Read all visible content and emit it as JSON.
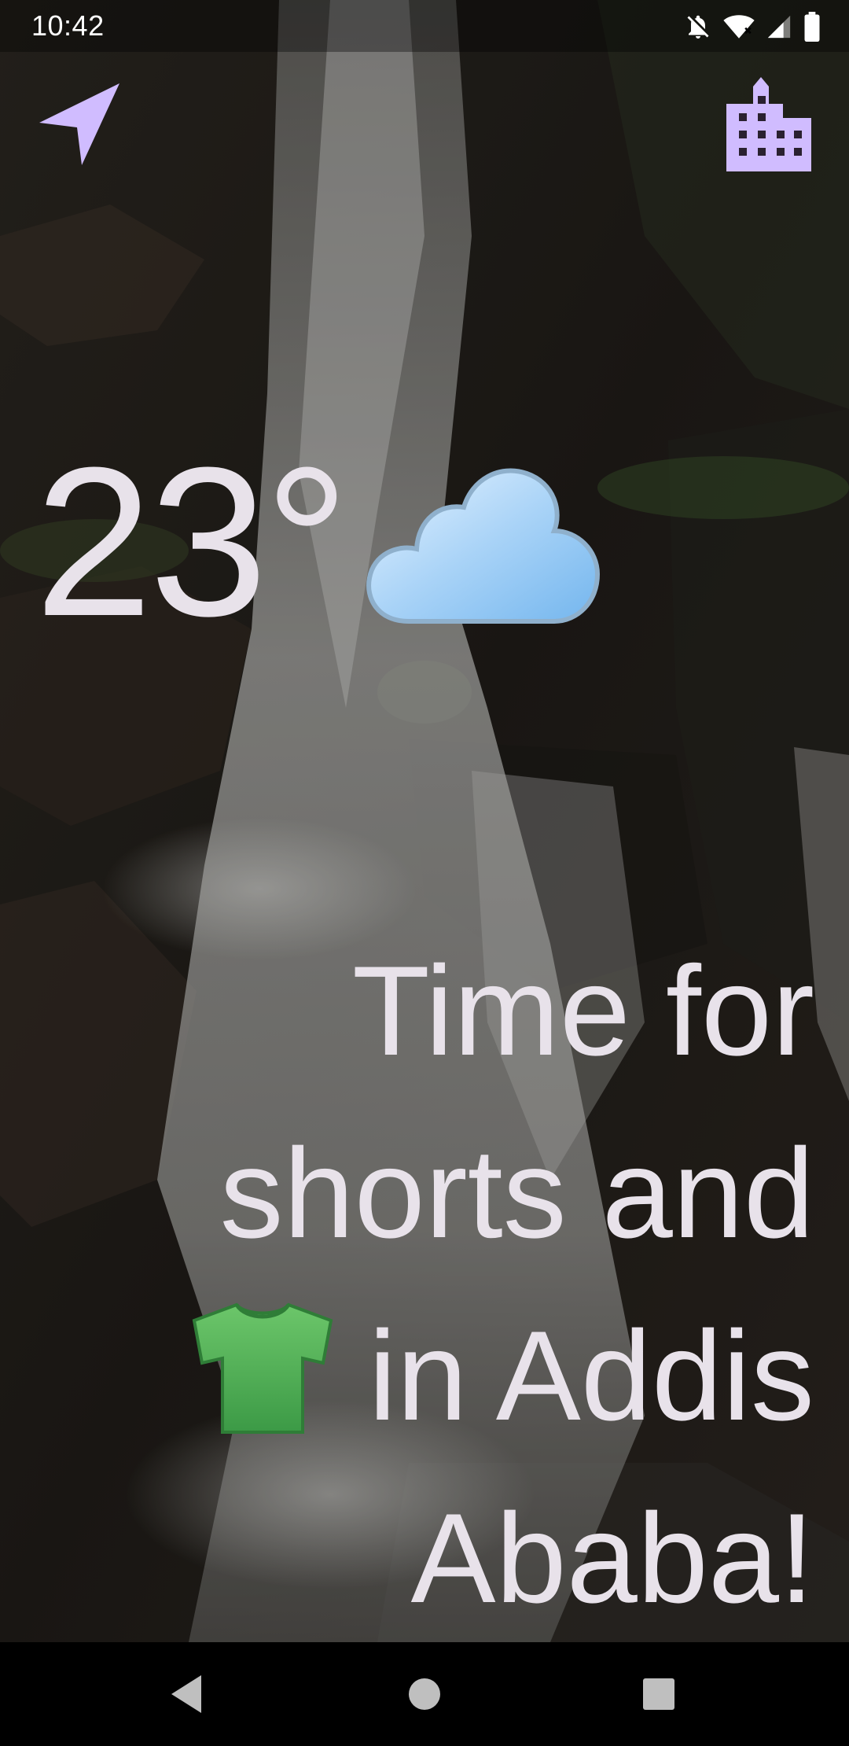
{
  "status_bar": {
    "time": "10:42",
    "icons": [
      "notifications-off-icon",
      "wifi-icon",
      "cell-signal-icon",
      "battery-icon"
    ]
  },
  "toolbar": {
    "location_icon": "navigation-arrow-icon",
    "city_icon": "city-buildings-icon",
    "accent_color": "#d0bcff"
  },
  "weather": {
    "temperature": "23°",
    "condition_icon": "cloud-icon"
  },
  "message": {
    "line1": "Time for",
    "line2": "shorts and",
    "line3_text": "in Addis",
    "line3_icon": "t-shirt-icon",
    "line4": "Ababa!"
  },
  "nav_bar": {
    "back_icon": "back-triangle-icon",
    "home_icon": "home-circle-icon",
    "recents_icon": "recents-square-icon"
  },
  "colors": {
    "text": "#e8e2ea",
    "accent": "#d0bcff",
    "background_dark": "#1e1b19"
  }
}
